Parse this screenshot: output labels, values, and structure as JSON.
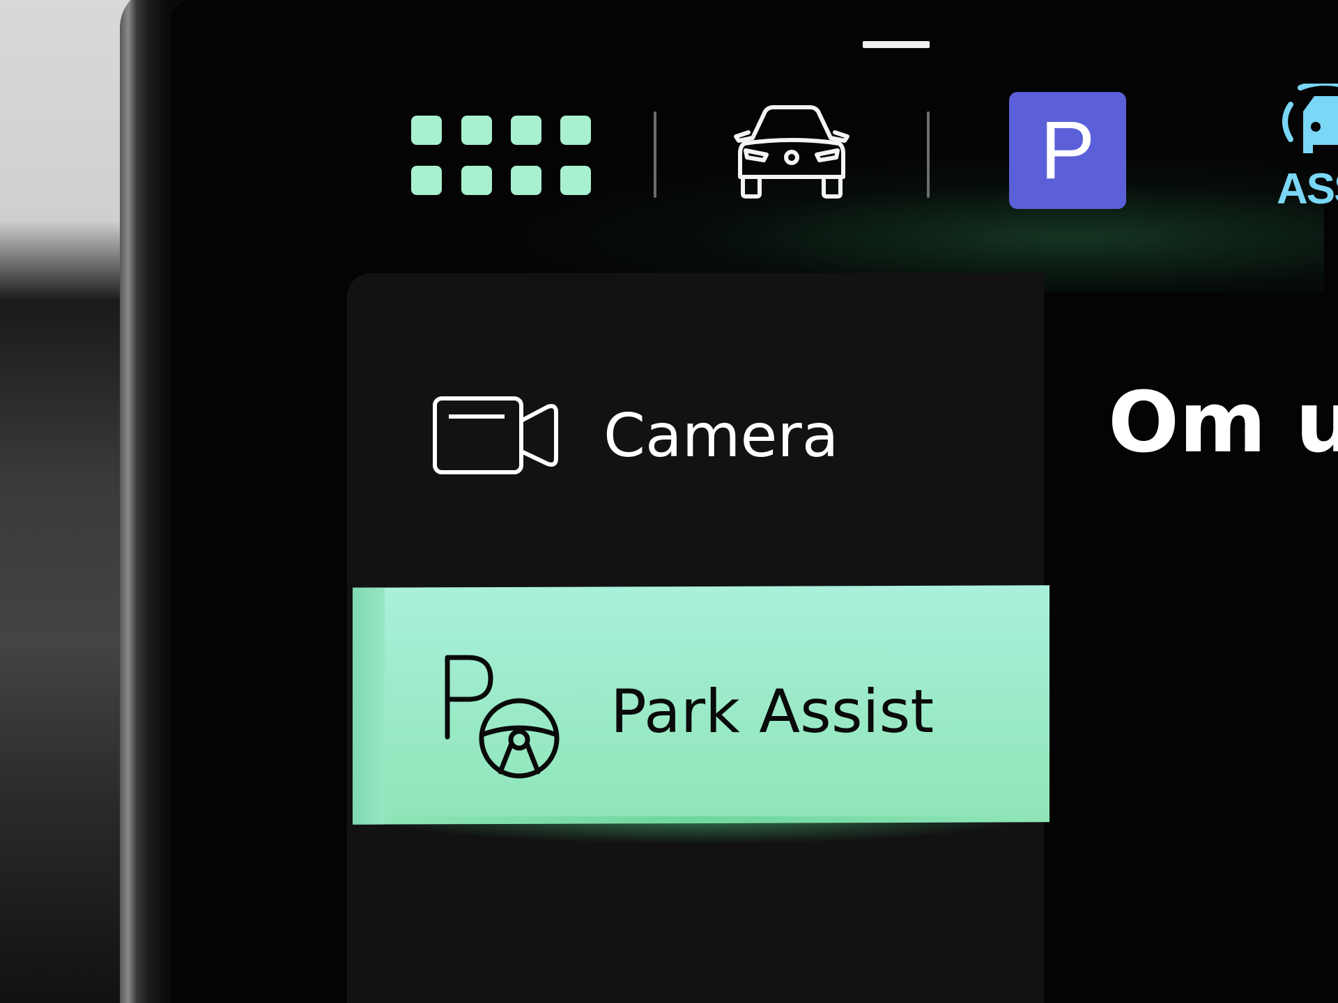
{
  "top_bar": {
    "apps_icon": "apps-grid-icon",
    "vehicle_icon": "car-front-icon",
    "parking_button_label": "P",
    "assist_label": "ASS",
    "assist_icon": "car-assist-icon"
  },
  "menu": {
    "items": [
      {
        "label": "Camera",
        "icon": "camera-icon",
        "selected": false
      },
      {
        "label": "Park Assist",
        "icon": "park-assist-steering-icon",
        "selected": true
      }
    ]
  },
  "content": {
    "title": "Om ui"
  },
  "colors": {
    "accent_green": "#9beac8",
    "apps_icon_green": "#a8f0cf",
    "parking_blue": "#5b5fd8",
    "assist_cyan": "#7ad7f5",
    "screen_bg": "#040404"
  }
}
